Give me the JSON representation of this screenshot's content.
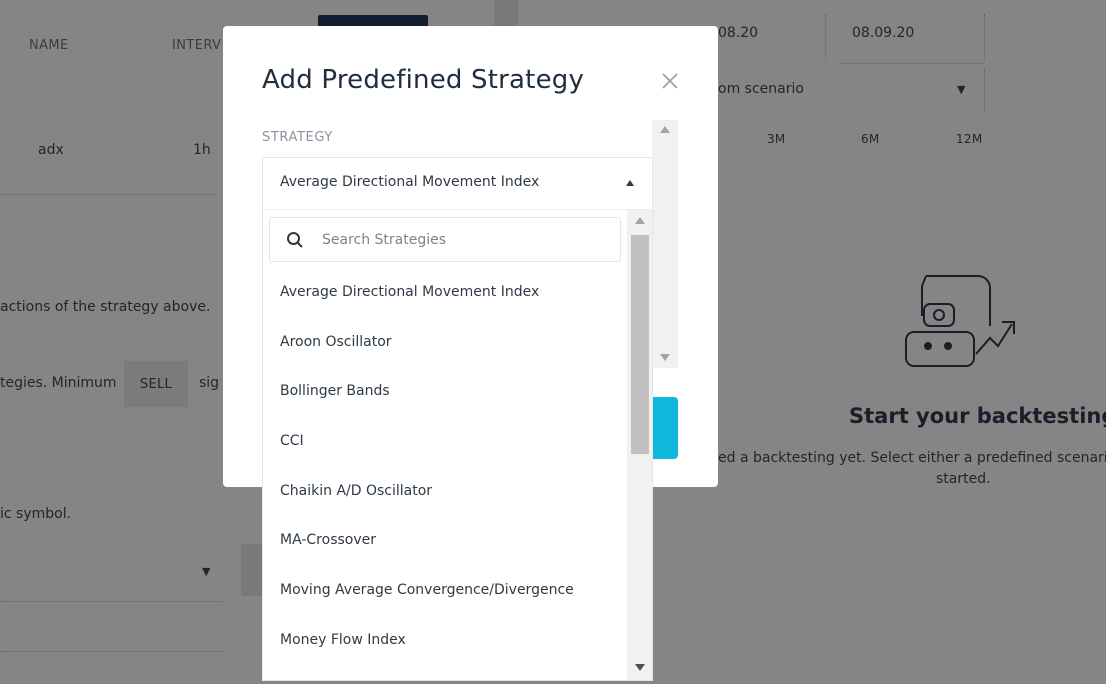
{
  "background": {
    "table": {
      "header_name": "NAME",
      "header_interval": "INTERV",
      "row_name": "adx",
      "row_interval": "1h"
    },
    "dates": {
      "start": "08.20",
      "end": "08.09.20"
    },
    "scenario_select": "om scenario",
    "ranges": [
      "3M",
      "6M",
      "12M"
    ],
    "text_actions": "actions of the strategy above.",
    "text_strategies": "tegies.  Minimum",
    "sell_label": "SELL",
    "text_sig": "sig",
    "text_symbol": "ic symbol.",
    "empty_state": {
      "title": "Start your backtesting",
      "line1": "ed a backtesting yet. Select either a predefined scenario",
      "line2": "started."
    }
  },
  "modal": {
    "title": "Add Predefined Strategy",
    "strategy_label": "STRATEGY",
    "selected_strategy": "Average Directional Movement Index",
    "search_placeholder": "Search Strategies",
    "options": [
      "Average Directional Movement Index",
      "Aroon Oscillator",
      "Bollinger Bands",
      "CCI",
      "Chaikin A/D Oscillator",
      "MA-Crossover",
      "Moving Average Convergence/Divergence",
      "Money Flow Index"
    ]
  },
  "colors": {
    "accent": "#11b6dd",
    "title": "#1f2d3c",
    "overlay": "rgba(0,0,0,0.48)"
  },
  "icons": {
    "close": "close-icon",
    "search": "search-icon",
    "caret": "caret-up-icon",
    "empty_state": "robot-chart-icon"
  }
}
